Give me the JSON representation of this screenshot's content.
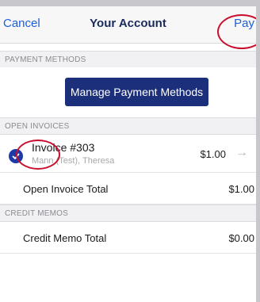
{
  "nav": {
    "cancel_label": "Cancel",
    "title": "Your Account",
    "pay_label": "Pay"
  },
  "sections": {
    "payment_methods": "PAYMENT METHODS",
    "open_invoices": "OPEN INVOICES",
    "credit_memos": "CREDIT MEMOS"
  },
  "manage_button_label": "Manage Payment Methods",
  "invoice": {
    "title": "Invoice #303",
    "customer": "Mann (Test), Theresa",
    "amount": "$1.00",
    "selected": true
  },
  "open_invoice_total": {
    "label": "Open Invoice Total",
    "value": "$1.00"
  },
  "credit_memo_total": {
    "label": "Credit Memo Total",
    "value": "$0.00"
  },
  "colors": {
    "accent": "#1d5fd6",
    "primary_button": "#1c2f7a",
    "annotation_ring": "#c8102e"
  },
  "icons": {
    "check": "check-circle-icon",
    "arrow": "arrow-right-icon"
  }
}
